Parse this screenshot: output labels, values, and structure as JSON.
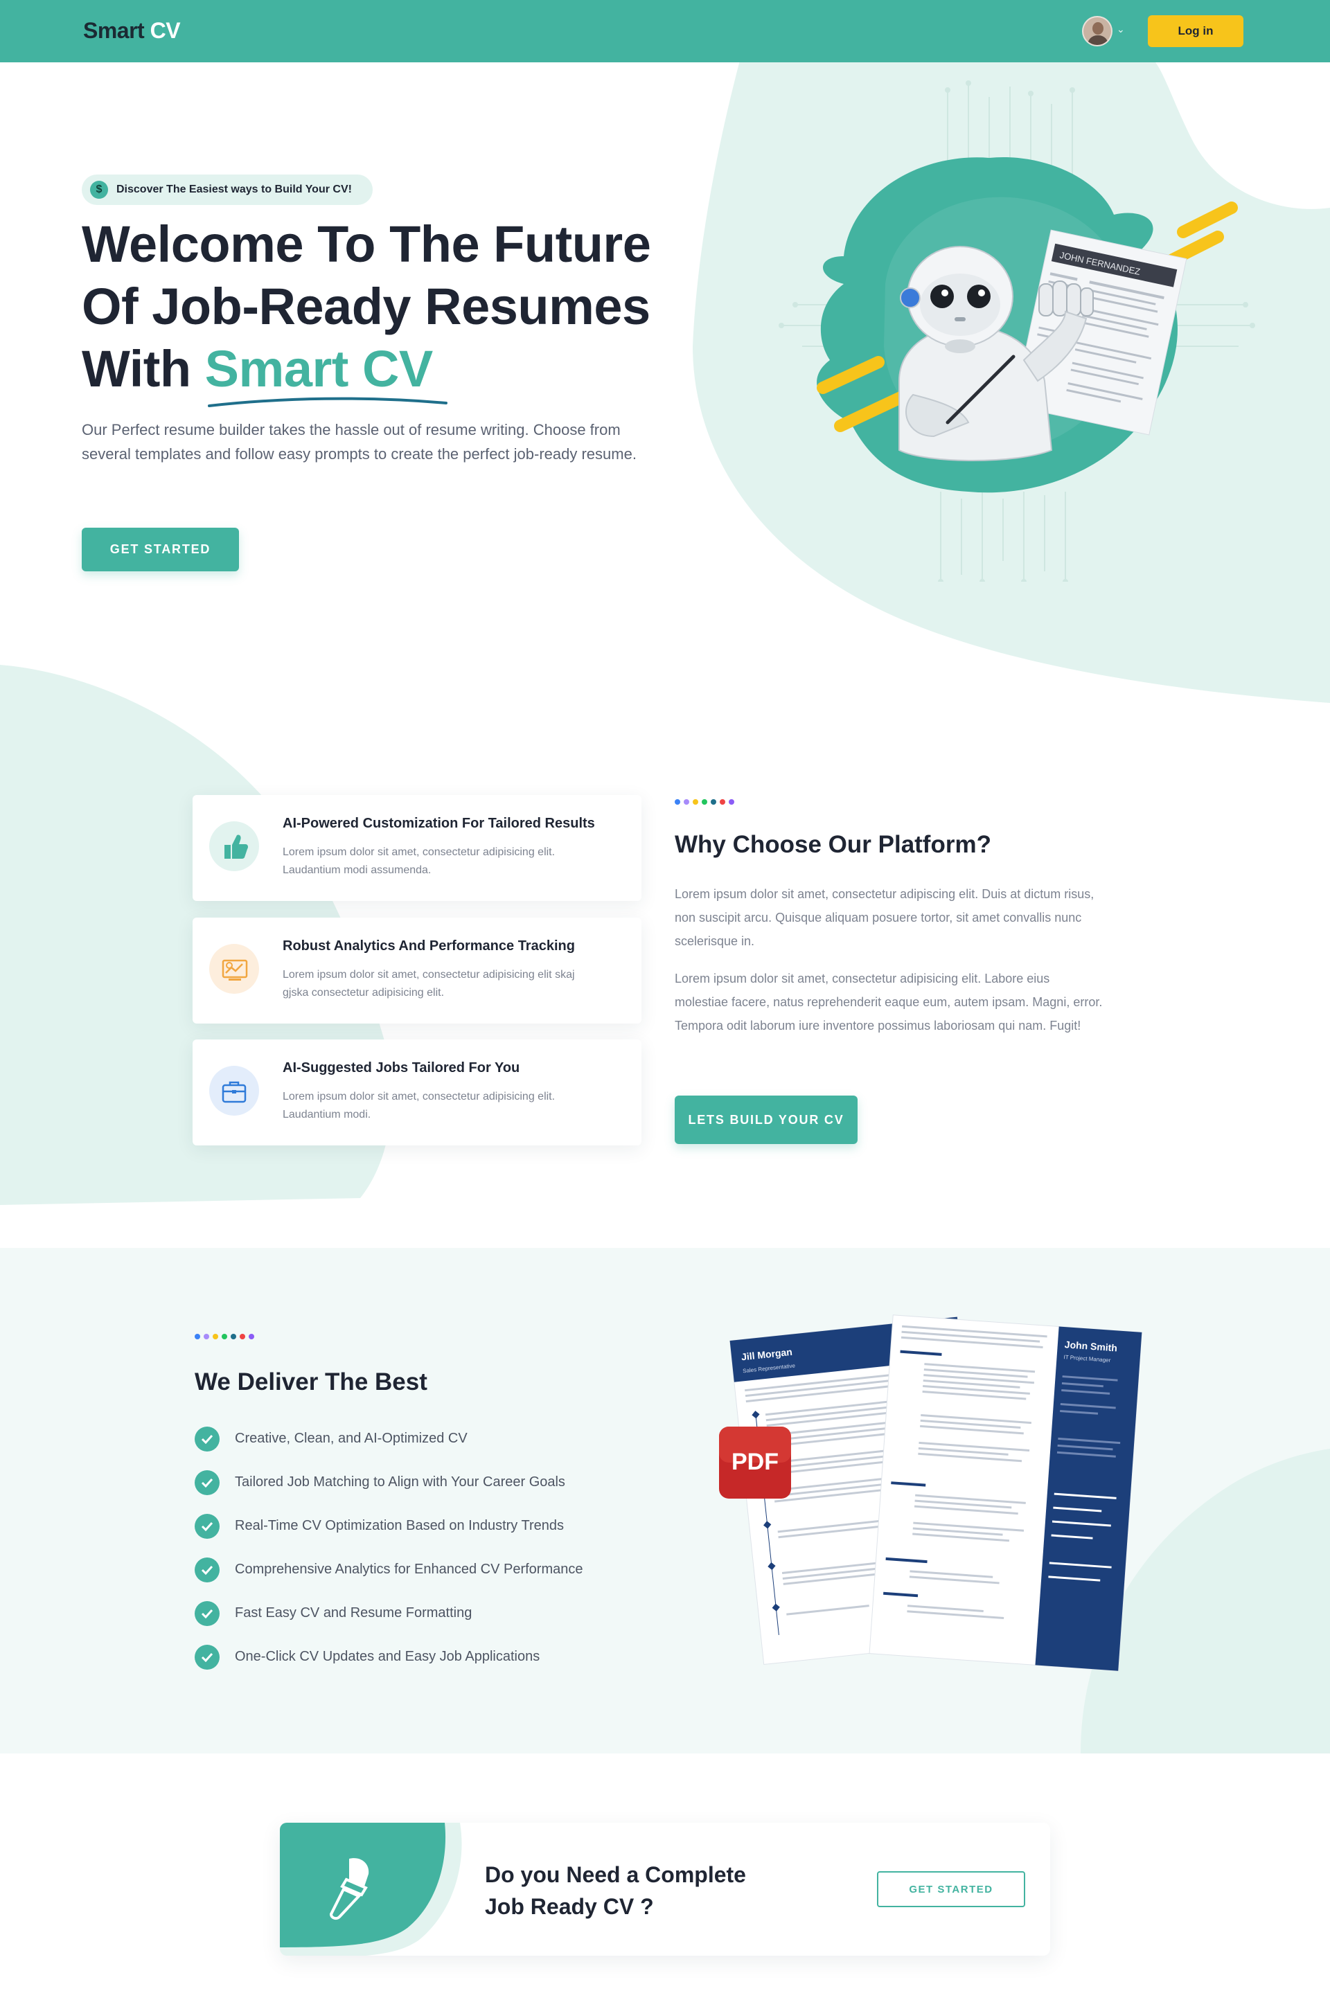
{
  "nav": {
    "logo_part1": "Smart",
    "logo_part2": "CV",
    "login_label": "Log in"
  },
  "hero": {
    "badge_icon": "$",
    "badge_text": "Discover The Easiest ways to Build Your CV!",
    "title_line1": "Welcome To The Future",
    "title_line2": "Of Job-Ready Resumes",
    "title_line3_prefix": "With ",
    "title_highlight": "Smart CV",
    "description": "Our Perfect resume builder takes the hassle out of resume writing. Choose from several templates and follow easy prompts to create the perfect job-ready resume.",
    "cta_label": "GET STARTED",
    "resume_name": "JOHN FERNANDEZ"
  },
  "features": {
    "cards": [
      {
        "icon": "thumbs-up-icon",
        "title": "AI-Powered Customization For Tailored Results",
        "text": "Lorem ipsum dolor sit amet, consectetur adipisicing elit. Laudantium modi assumenda."
      },
      {
        "icon": "analytics-icon",
        "title": "Robust Analytics And Performance Tracking",
        "text": "Lorem ipsum dolor sit amet, consectetur adipisicing elit skaj gjska consectetur adipisicing elit."
      },
      {
        "icon": "briefcase-icon",
        "title": "AI-Suggested Jobs Tailored For You",
        "text": "Lorem ipsum dolor sit amet, consectetur adipisicing elit. Laudantium modi."
      }
    ],
    "why_title": "Why Choose Our Platform?",
    "why_p1": "Lorem ipsum dolor sit amet, consectetur adipiscing elit. Duis at dictum risus, non suscipit arcu. Quisque aliquam posuere tortor, sit amet convallis nunc scelerisque in.",
    "why_p2": "Lorem ipsum dolor sit amet, consectetur adipisicing elit. Labore eius molestiae facere, natus reprehenderit eaque eum, autem ipsam. Magni, error. Tempora odit laborum iure inventore possimus laboriosam qui nam. Fugit!",
    "build_label": "LETS BUILD YOUR CV"
  },
  "dot_colors": [
    "#3b82f6",
    "#a78bfa",
    "#f7c41b",
    "#22c55e",
    "#1f6f8b",
    "#ef4444",
    "#8b5cf6"
  ],
  "deliver": {
    "title": "We Deliver The Best",
    "items": [
      "Creative, Clean, and AI-Optimized CV",
      "Tailored Job Matching to Align with Your Career Goals",
      "Real-Time CV Optimization Based on Industry Trends",
      "Comprehensive Analytics for Enhanced CV Performance",
      "Fast Easy CV and Resume Formatting",
      "One-Click CV Updates and Easy Job Applications"
    ],
    "pdf_label": "PDF",
    "resume1_name": "Jill Morgan",
    "resume1_role": "Sales Representative",
    "resume2_name": "John Smith",
    "resume2_role": "IT Project Manager"
  },
  "cta": {
    "title": "Do you Need a Complete Job Ready CV ?",
    "button_label": "GET STARTED"
  },
  "colors": {
    "brand_teal": "#43b3a0",
    "accent_yellow": "#f7c41b",
    "light_teal": "#e2f3ef",
    "dark_text": "#1f2533"
  }
}
